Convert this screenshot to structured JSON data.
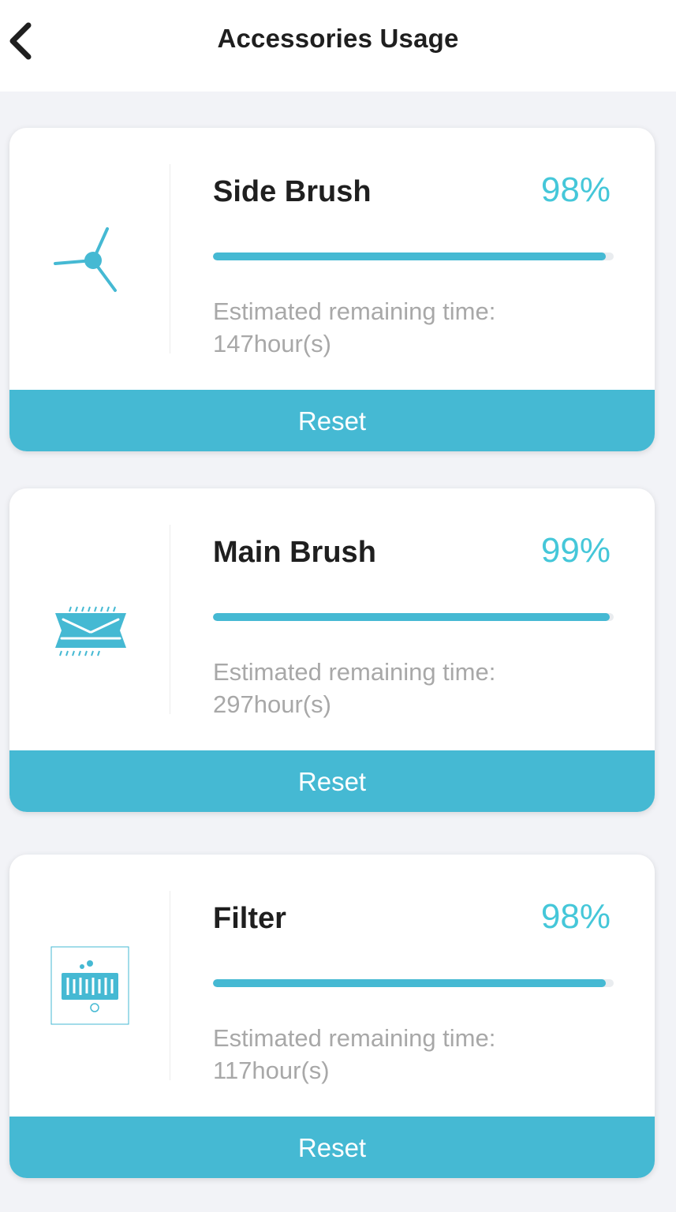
{
  "header": {
    "title": "Accessories Usage",
    "back_icon": "chevron-left-icon"
  },
  "accent_color": "#45b9d3",
  "percent_color": "#45c7d9",
  "accessories": [
    {
      "name": "Side Brush",
      "icon": "side-brush-icon",
      "percent_label": "98%",
      "percent": 98,
      "remaining_label": "Estimated remaining time:",
      "remaining_value": "147hour(s)",
      "reset_label": "Reset"
    },
    {
      "name": "Main Brush",
      "icon": "main-brush-icon",
      "percent_label": "99%",
      "percent": 99,
      "remaining_label": "Estimated remaining time:",
      "remaining_value": "297hour(s)",
      "reset_label": "Reset"
    },
    {
      "name": "Filter",
      "icon": "filter-icon",
      "percent_label": "98%",
      "percent": 98,
      "remaining_label": "Estimated remaining time:",
      "remaining_value": "117hour(s)",
      "reset_label": "Reset"
    }
  ]
}
